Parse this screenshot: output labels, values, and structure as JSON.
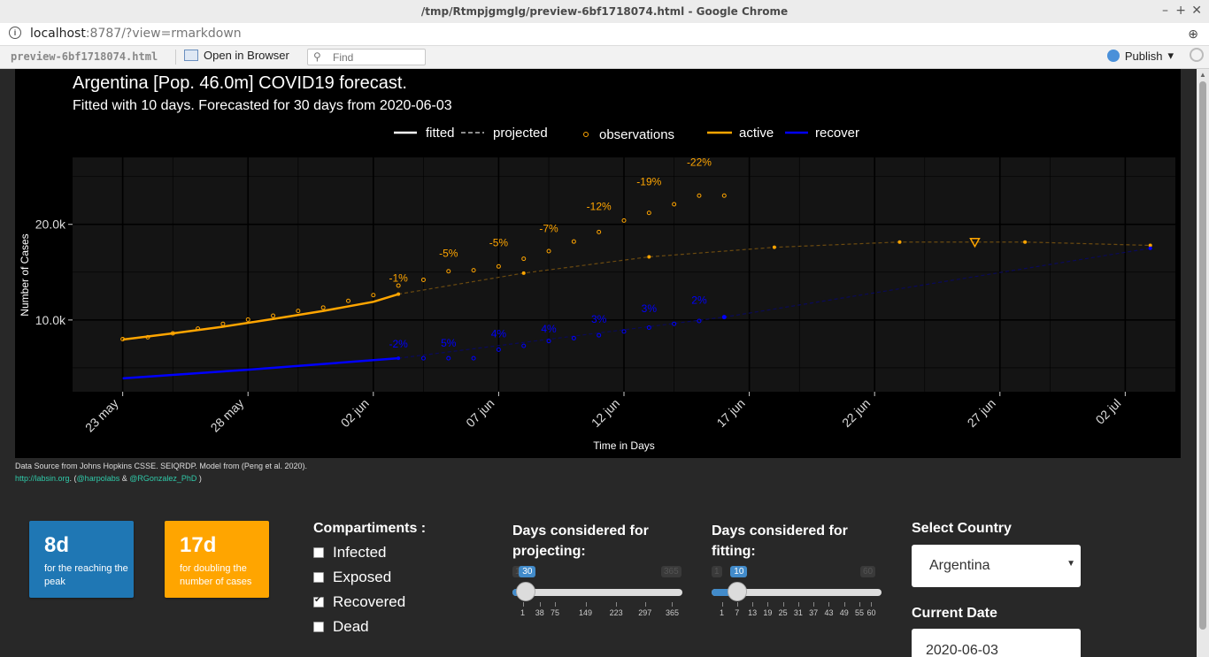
{
  "window": {
    "title": "/tmp/Rtmpjgmglg/preview-6bf1718074.html - Google Chrome"
  },
  "address": {
    "host": "localhost",
    "rest": ":8787/?view=rmarkdown"
  },
  "viewer": {
    "filename": "preview-6bf1718074.html",
    "open_label": "Open in Browser",
    "find_placeholder": "Find",
    "publish_label": "Publish"
  },
  "chart_data": {
    "type": "line",
    "title": "Argentina [Pop. 46.0m] COVID19 forecast.",
    "subtitle": "Fitted with 10 days. Forecasted for 30 days from 2020-06-03",
    "xlabel": "Time in Days",
    "ylabel": "Number of Cases",
    "x_tick_labels": [
      "23 may",
      "28 may",
      "02 jun",
      "07 jun",
      "12 jun",
      "17 jun",
      "22 jun",
      "27 jun",
      "02 jul"
    ],
    "y_tick_labels": [
      "10.0k",
      "20.0k"
    ],
    "xlim": [
      "2020-05-21",
      "2020-07-04"
    ],
    "ylim": [
      2500,
      27000
    ],
    "legend": {
      "position": "top",
      "entries": [
        "fitted",
        "projected",
        "observations",
        "active",
        "recover"
      ]
    },
    "colors": {
      "active": "#FFA500",
      "recover": "#0000FF"
    },
    "series": [
      {
        "name": "active",
        "kind": "fitted",
        "x": [
          "2020-05-23",
          "2020-05-25",
          "2020-05-27",
          "2020-05-29",
          "2020-05-31",
          "2020-06-02",
          "2020-06-03"
        ],
        "values": [
          7950,
          8600,
          9300,
          10100,
          10950,
          11900,
          12700
        ]
      },
      {
        "name": "active",
        "kind": "projected",
        "x": [
          "2020-06-03",
          "2020-06-08",
          "2020-06-13",
          "2020-06-18",
          "2020-06-23",
          "2020-06-28",
          "2020-07-03"
        ],
        "values": [
          12700,
          14900,
          16600,
          17600,
          18150,
          18150,
          17800
        ]
      },
      {
        "name": "active",
        "kind": "observations",
        "x": [
          "2020-05-23",
          "2020-05-24",
          "2020-05-25",
          "2020-05-26",
          "2020-05-27",
          "2020-05-28",
          "2020-05-29",
          "2020-05-30",
          "2020-05-31",
          "2020-06-01",
          "2020-06-02",
          "2020-06-03",
          "2020-06-04",
          "2020-06-05",
          "2020-06-06",
          "2020-06-07",
          "2020-06-08",
          "2020-06-09",
          "2020-06-10",
          "2020-06-11",
          "2020-06-12",
          "2020-06-13",
          "2020-06-14",
          "2020-06-15",
          "2020-06-16"
        ],
        "values": [
          8000,
          8200,
          8600,
          9100,
          9600,
          10050,
          10450,
          10950,
          11300,
          12000,
          12600,
          13600,
          14200,
          15100,
          15200,
          15600,
          16400,
          17200,
          18200,
          19200,
          20400,
          21200,
          22100,
          23000,
          23000
        ]
      },
      {
        "name": "recover",
        "kind": "fitted",
        "x": [
          "2020-05-23",
          "2020-05-28",
          "2020-06-03"
        ],
        "values": [
          3900,
          4800,
          6000
        ]
      },
      {
        "name": "recover",
        "kind": "projected",
        "x": [
          "2020-06-03",
          "2020-06-16",
          "2020-07-03"
        ],
        "values": [
          6000,
          10300,
          17500
        ]
      },
      {
        "name": "recover",
        "kind": "observations",
        "x": [
          "2020-06-04",
          "2020-06-05",
          "2020-06-06",
          "2020-06-07",
          "2020-06-08",
          "2020-06-09",
          "2020-06-10",
          "2020-06-11",
          "2020-06-12",
          "2020-06-13",
          "2020-06-14",
          "2020-06-15",
          "2020-06-16"
        ],
        "values": [
          6000,
          6000,
          6000,
          6900,
          7300,
          7800,
          8100,
          8400,
          8800,
          9200,
          9600,
          9900,
          10300
        ]
      }
    ],
    "annotations": [
      {
        "text": "-1%",
        "x": "2020-06-03",
        "y": 14000,
        "color": "#FFA500"
      },
      {
        "text": "-5%",
        "x": "2020-06-05",
        "y": 16600,
        "color": "#FFA500"
      },
      {
        "text": "-5%",
        "x": "2020-06-07",
        "y": 17700,
        "color": "#FFA500"
      },
      {
        "text": "-7%",
        "x": "2020-06-09",
        "y": 19200,
        "color": "#FFA500"
      },
      {
        "text": "-12%",
        "x": "2020-06-11",
        "y": 21500,
        "color": "#FFA500"
      },
      {
        "text": "-19%",
        "x": "2020-06-13",
        "y": 24100,
        "color": "#FFA500"
      },
      {
        "text": "-22%",
        "x": "2020-06-15",
        "y": 26100,
        "color": "#FFA500"
      },
      {
        "text": "-2%",
        "x": "2020-06-03",
        "y": 7100,
        "color": "#0000FF"
      },
      {
        "text": "5%",
        "x": "2020-06-05",
        "y": 7200,
        "color": "#0000FF"
      },
      {
        "text": "4%",
        "x": "2020-06-07",
        "y": 8200,
        "color": "#0000FF"
      },
      {
        "text": "4%",
        "x": "2020-06-09",
        "y": 8700,
        "color": "#0000FF"
      },
      {
        "text": "3%",
        "x": "2020-06-11",
        "y": 9700,
        "color": "#0000FF"
      },
      {
        "text": "3%",
        "x": "2020-06-13",
        "y": 10800,
        "color": "#0000FF"
      },
      {
        "text": "2%",
        "x": "2020-06-15",
        "y": 11700,
        "color": "#0000FF"
      }
    ],
    "peak_marker": {
      "x": "2020-06-26",
      "y": 18150
    }
  },
  "caption": {
    "line1": "Data Source from Johns Hopkins CSSE. SEIQRDP. Model from (Peng et al. 2020).",
    "link1": "http://labsin.org",
    "mid1": ". (",
    "link2": "@harpolabs",
    "mid2": " & ",
    "link3": "@RGonzalez_PhD",
    "end": " )"
  },
  "value_boxes": [
    {
      "value": "8d",
      "label": "for the reaching the peak",
      "color": "#1f77b4"
    },
    {
      "value": "17d",
      "label": "for doubling the number of cases",
      "color": "#FFA500"
    }
  ],
  "compartments": {
    "title": "Compartiments :",
    "items": [
      {
        "label": "Infected",
        "checked": false
      },
      {
        "label": "Exposed",
        "checked": false
      },
      {
        "label": "Recovered",
        "checked": true
      },
      {
        "label": "Dead",
        "checked": false
      }
    ]
  },
  "slider_projecting": {
    "label": "Days considered for projecting:",
    "value": "30",
    "min": "1",
    "max": "365",
    "value_fraction": 0.0797,
    "ticks": [
      "1",
      "38",
      "75",
      "149",
      "223",
      "297",
      "365"
    ]
  },
  "slider_fitting": {
    "label": "Days considered for fitting:",
    "value": "10",
    "min": "1",
    "max": "60",
    "value_fraction": 0.1525,
    "ticks": [
      "1",
      "7",
      "13",
      "19",
      "25",
      "31",
      "37",
      "43",
      "49",
      "55",
      "60"
    ]
  },
  "country": {
    "label": "Select Country",
    "value": "Argentina",
    "date_label": "Current Date",
    "date_value": "2020-06-03"
  }
}
